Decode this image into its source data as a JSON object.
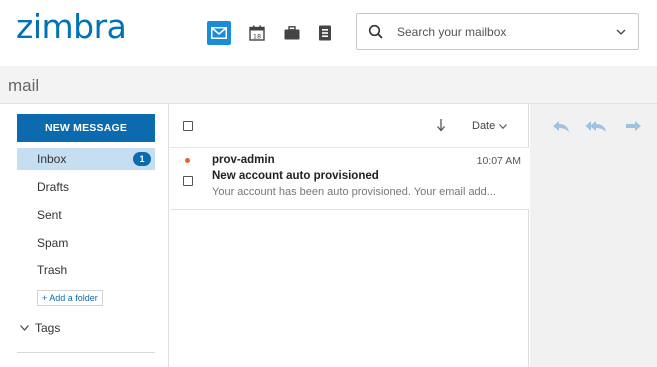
{
  "header": {
    "logo_text": "zimbra",
    "apps": [
      {
        "name": "mail",
        "icon": "envelope-icon",
        "active": true
      },
      {
        "name": "calendar",
        "icon": "calendar-icon",
        "active": false,
        "date_text": "18"
      },
      {
        "name": "briefcase",
        "icon": "briefcase-icon",
        "active": false
      },
      {
        "name": "contacts",
        "icon": "contacts-icon",
        "active": false
      }
    ],
    "search": {
      "placeholder": "Search your mailbox",
      "value": ""
    }
  },
  "app_title": "mail",
  "sidebar": {
    "new_message_label": "NEW MESSAGE",
    "folders": [
      {
        "label": "Inbox",
        "selected": true,
        "badge": "1"
      },
      {
        "label": "Drafts",
        "selected": false
      },
      {
        "label": "Sent",
        "selected": false
      },
      {
        "label": "Spam",
        "selected": false
      },
      {
        "label": "Trash",
        "selected": false
      }
    ],
    "add_folder_label": "+ Add a folder",
    "tags_label": "Tags"
  },
  "message_list": {
    "sort_label": "Date",
    "messages": [
      {
        "sender": "prov-admin",
        "time": "10:07 AM",
        "subject": "New account auto provisioned",
        "preview": "Your account has been auto provisioned. Your email add...",
        "unread": true
      }
    ]
  },
  "colors": {
    "brand": "#0073b6",
    "accent": "#0c6bae",
    "active_app": "#1a8dd6",
    "selected_folder": "#c6def2",
    "unread_dot": "#e8632c",
    "reading_icons": "#9fc2e2"
  }
}
